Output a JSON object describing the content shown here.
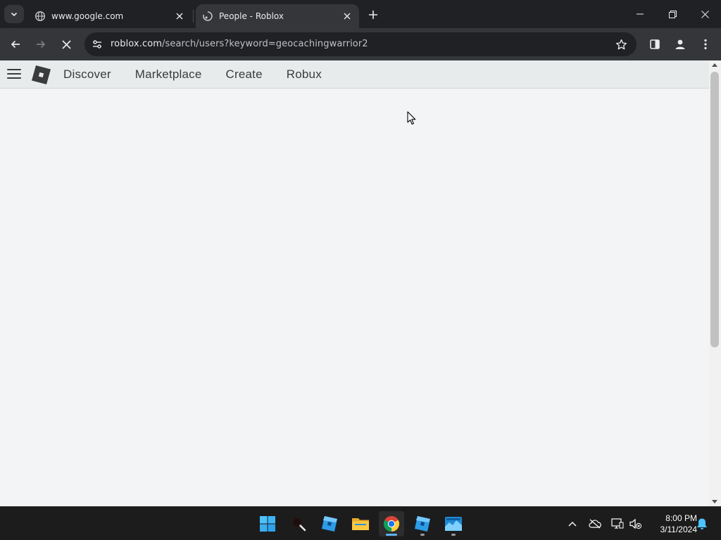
{
  "browser": {
    "tabs": [
      {
        "title": "www.google.com",
        "favicon": "globe-icon",
        "active": false
      },
      {
        "title": "People - Roblox",
        "favicon": "loading-spinner-icon",
        "active": true
      }
    ],
    "omnibox": {
      "url_domain": "roblox.com",
      "url_path": "/search/users?keyword=geocachingwarrior2"
    },
    "theme": {
      "frame": "#202124",
      "toolbar": "#35363a"
    }
  },
  "page": {
    "nav_links": [
      "Discover",
      "Marketplace",
      "Create",
      "Robux"
    ],
    "background": "#f2f4f5"
  },
  "taskbar": {
    "apps": [
      {
        "name": "start-button",
        "icon": "windows-logo-icon"
      },
      {
        "name": "search-button",
        "icon": "search-icon"
      },
      {
        "name": "roblox-studio",
        "icon": "roblox-studio-icon"
      },
      {
        "name": "file-explorer",
        "icon": "folder-icon"
      },
      {
        "name": "chrome",
        "icon": "chrome-icon"
      },
      {
        "name": "roblox-player",
        "icon": "roblox-studio-icon"
      },
      {
        "name": "photos",
        "icon": "photos-icon"
      }
    ],
    "clock": {
      "time": "8:00 PM",
      "date": "3/11/2024"
    }
  }
}
